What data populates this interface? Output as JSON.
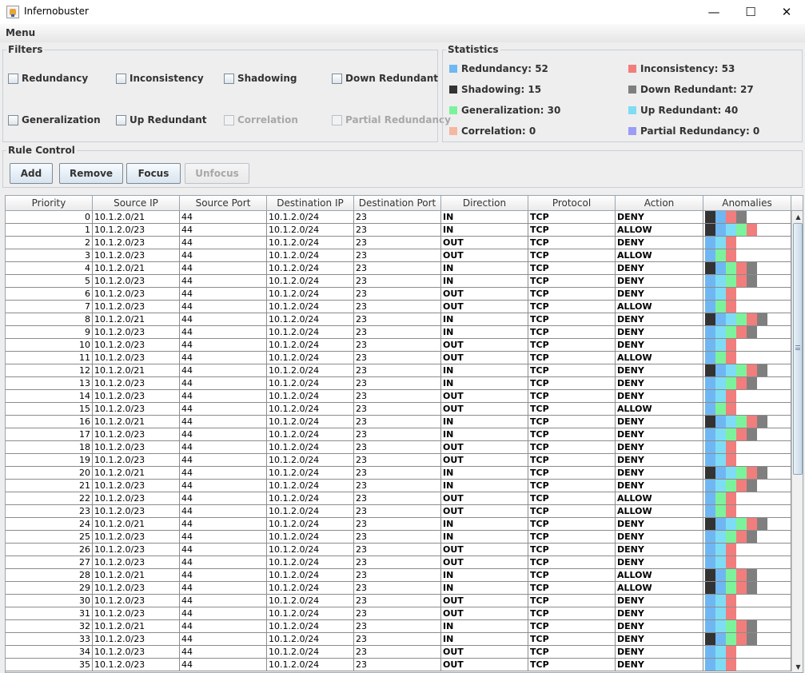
{
  "window": {
    "title": "Infernobuster",
    "minimize_glyph": "—",
    "maximize_glyph": "☐",
    "close_glyph": "✕"
  },
  "menubar": {
    "menu_label": "Menu"
  },
  "filters": {
    "title": "Filters",
    "items": [
      {
        "label": "Redundancy",
        "enabled": true,
        "checked": false
      },
      {
        "label": "Inconsistency",
        "enabled": true,
        "checked": false
      },
      {
        "label": "Shadowing",
        "enabled": true,
        "checked": false
      },
      {
        "label": "Down Redundant",
        "enabled": true,
        "checked": false
      },
      {
        "label": "Generalization",
        "enabled": true,
        "checked": false
      },
      {
        "label": "Up Redundant",
        "enabled": true,
        "checked": false
      },
      {
        "label": "Correlation",
        "enabled": false,
        "checked": false
      },
      {
        "label": "Partial Redundancy",
        "enabled": false,
        "checked": false
      }
    ]
  },
  "statistics": {
    "title": "Statistics",
    "items": [
      {
        "label": "Redundancy: 52",
        "color": "#6fb7f2"
      },
      {
        "label": "Inconsistency: 53",
        "color": "#f27d7d"
      },
      {
        "label": "Shadowing: 15",
        "color": "#333333"
      },
      {
        "label": "Down Redundant: 27",
        "color": "#7f7f7f"
      },
      {
        "label": "Generalization: 30",
        "color": "#7df29c"
      },
      {
        "label": "Up Redundant: 40",
        "color": "#7fdcf5"
      },
      {
        "label": "Correlation: 0",
        "color": "#f5b7a0"
      },
      {
        "label": "Partial Redundancy: 0",
        "color": "#9c9cf5"
      }
    ]
  },
  "rule_control": {
    "title": "Rule Control",
    "add_label": "Add",
    "remove_label": "Remove",
    "focus_label": "Focus",
    "unfocus_label": "Unfocus"
  },
  "anomaly_colors": {
    "S": "#333333",
    "R": "#6fb7f2",
    "U": "#7fdcf5",
    "G": "#7df29c",
    "I": "#f27d7d",
    "D": "#7f7f7f"
  },
  "table": {
    "columns": [
      "Priority",
      "Source IP",
      "Source Port",
      "Destination IP",
      "Destination Port",
      "Direction",
      "Protocol",
      "Action",
      "Anomalies"
    ],
    "rows": [
      {
        "priority": "0",
        "src_ip": "10.1.2.0/21",
        "src_port": "44",
        "dst_ip": "10.1.2.0/24",
        "dst_port": "23",
        "direction": "IN",
        "protocol": "TCP",
        "action": "DENY",
        "anomalies": [
          "S",
          "R",
          "I",
          "D"
        ]
      },
      {
        "priority": "1",
        "src_ip": "10.1.2.0/23",
        "src_port": "44",
        "dst_ip": "10.1.2.0/24",
        "dst_port": "23",
        "direction": "IN",
        "protocol": "TCP",
        "action": "ALLOW",
        "anomalies": [
          "S",
          "R",
          "U",
          "G",
          "I"
        ]
      },
      {
        "priority": "2",
        "src_ip": "10.1.2.0/23",
        "src_port": "44",
        "dst_ip": "10.1.2.0/24",
        "dst_port": "23",
        "direction": "OUT",
        "protocol": "TCP",
        "action": "DENY",
        "anomalies": [
          "R",
          "U",
          "I"
        ]
      },
      {
        "priority": "3",
        "src_ip": "10.1.2.0/23",
        "src_port": "44",
        "dst_ip": "10.1.2.0/24",
        "dst_port": "23",
        "direction": "OUT",
        "protocol": "TCP",
        "action": "ALLOW",
        "anomalies": [
          "R",
          "G",
          "I"
        ]
      },
      {
        "priority": "4",
        "src_ip": "10.1.2.0/21",
        "src_port": "44",
        "dst_ip": "10.1.2.0/24",
        "dst_port": "23",
        "direction": "IN",
        "protocol": "TCP",
        "action": "DENY",
        "anomalies": [
          "S",
          "R",
          "G",
          "I",
          "D"
        ]
      },
      {
        "priority": "5",
        "src_ip": "10.1.2.0/23",
        "src_port": "44",
        "dst_ip": "10.1.2.0/24",
        "dst_port": "23",
        "direction": "IN",
        "protocol": "TCP",
        "action": "DENY",
        "anomalies": [
          "R",
          "U",
          "G",
          "I",
          "D"
        ]
      },
      {
        "priority": "6",
        "src_ip": "10.1.2.0/23",
        "src_port": "44",
        "dst_ip": "10.1.2.0/24",
        "dst_port": "23",
        "direction": "OUT",
        "protocol": "TCP",
        "action": "DENY",
        "anomalies": [
          "R",
          "U",
          "I"
        ]
      },
      {
        "priority": "7",
        "src_ip": "10.1.2.0/23",
        "src_port": "44",
        "dst_ip": "10.1.2.0/24",
        "dst_port": "23",
        "direction": "OUT",
        "protocol": "TCP",
        "action": "ALLOW",
        "anomalies": [
          "R",
          "G",
          "I"
        ]
      },
      {
        "priority": "8",
        "src_ip": "10.1.2.0/21",
        "src_port": "44",
        "dst_ip": "10.1.2.0/24",
        "dst_port": "23",
        "direction": "IN",
        "protocol": "TCP",
        "action": "DENY",
        "anomalies": [
          "S",
          "R",
          "U",
          "G",
          "I",
          "D"
        ]
      },
      {
        "priority": "9",
        "src_ip": "10.1.2.0/23",
        "src_port": "44",
        "dst_ip": "10.1.2.0/24",
        "dst_port": "23",
        "direction": "IN",
        "protocol": "TCP",
        "action": "DENY",
        "anomalies": [
          "R",
          "U",
          "G",
          "I",
          "D"
        ]
      },
      {
        "priority": "10",
        "src_ip": "10.1.2.0/23",
        "src_port": "44",
        "dst_ip": "10.1.2.0/24",
        "dst_port": "23",
        "direction": "OUT",
        "protocol": "TCP",
        "action": "DENY",
        "anomalies": [
          "R",
          "U",
          "I"
        ]
      },
      {
        "priority": "11",
        "src_ip": "10.1.2.0/23",
        "src_port": "44",
        "dst_ip": "10.1.2.0/24",
        "dst_port": "23",
        "direction": "OUT",
        "protocol": "TCP",
        "action": "ALLOW",
        "anomalies": [
          "R",
          "G",
          "I"
        ]
      },
      {
        "priority": "12",
        "src_ip": "10.1.2.0/21",
        "src_port": "44",
        "dst_ip": "10.1.2.0/24",
        "dst_port": "23",
        "direction": "IN",
        "protocol": "TCP",
        "action": "DENY",
        "anomalies": [
          "S",
          "R",
          "U",
          "G",
          "I",
          "D"
        ]
      },
      {
        "priority": "13",
        "src_ip": "10.1.2.0/23",
        "src_port": "44",
        "dst_ip": "10.1.2.0/24",
        "dst_port": "23",
        "direction": "IN",
        "protocol": "TCP",
        "action": "DENY",
        "anomalies": [
          "R",
          "U",
          "G",
          "I",
          "D"
        ]
      },
      {
        "priority": "14",
        "src_ip": "10.1.2.0/23",
        "src_port": "44",
        "dst_ip": "10.1.2.0/24",
        "dst_port": "23",
        "direction": "OUT",
        "protocol": "TCP",
        "action": "DENY",
        "anomalies": [
          "R",
          "U",
          "I"
        ]
      },
      {
        "priority": "15",
        "src_ip": "10.1.2.0/23",
        "src_port": "44",
        "dst_ip": "10.1.2.0/24",
        "dst_port": "23",
        "direction": "OUT",
        "protocol": "TCP",
        "action": "ALLOW",
        "anomalies": [
          "R",
          "G",
          "I"
        ]
      },
      {
        "priority": "16",
        "src_ip": "10.1.2.0/21",
        "src_port": "44",
        "dst_ip": "10.1.2.0/24",
        "dst_port": "23",
        "direction": "IN",
        "protocol": "TCP",
        "action": "DENY",
        "anomalies": [
          "S",
          "R",
          "U",
          "G",
          "I",
          "D"
        ]
      },
      {
        "priority": "17",
        "src_ip": "10.1.2.0/23",
        "src_port": "44",
        "dst_ip": "10.1.2.0/24",
        "dst_port": "23",
        "direction": "IN",
        "protocol": "TCP",
        "action": "DENY",
        "anomalies": [
          "R",
          "U",
          "G",
          "I",
          "D"
        ]
      },
      {
        "priority": "18",
        "src_ip": "10.1.2.0/23",
        "src_port": "44",
        "dst_ip": "10.1.2.0/24",
        "dst_port": "23",
        "direction": "OUT",
        "protocol": "TCP",
        "action": "DENY",
        "anomalies": [
          "R",
          "U",
          "I"
        ]
      },
      {
        "priority": "19",
        "src_ip": "10.1.2.0/23",
        "src_port": "44",
        "dst_ip": "10.1.2.0/24",
        "dst_port": "23",
        "direction": "OUT",
        "protocol": "TCP",
        "action": "DENY",
        "anomalies": [
          "R",
          "U",
          "I"
        ]
      },
      {
        "priority": "20",
        "src_ip": "10.1.2.0/21",
        "src_port": "44",
        "dst_ip": "10.1.2.0/24",
        "dst_port": "23",
        "direction": "IN",
        "protocol": "TCP",
        "action": "DENY",
        "anomalies": [
          "S",
          "R",
          "U",
          "G",
          "I",
          "D"
        ]
      },
      {
        "priority": "21",
        "src_ip": "10.1.2.0/23",
        "src_port": "44",
        "dst_ip": "10.1.2.0/24",
        "dst_port": "23",
        "direction": "IN",
        "protocol": "TCP",
        "action": "DENY",
        "anomalies": [
          "R",
          "U",
          "G",
          "I",
          "D"
        ]
      },
      {
        "priority": "22",
        "src_ip": "10.1.2.0/23",
        "src_port": "44",
        "dst_ip": "10.1.2.0/24",
        "dst_port": "23",
        "direction": "OUT",
        "protocol": "TCP",
        "action": "ALLOW",
        "anomalies": [
          "R",
          "G",
          "I"
        ]
      },
      {
        "priority": "23",
        "src_ip": "10.1.2.0/23",
        "src_port": "44",
        "dst_ip": "10.1.2.0/24",
        "dst_port": "23",
        "direction": "OUT",
        "protocol": "TCP",
        "action": "ALLOW",
        "anomalies": [
          "R",
          "G",
          "I"
        ]
      },
      {
        "priority": "24",
        "src_ip": "10.1.2.0/21",
        "src_port": "44",
        "dst_ip": "10.1.2.0/24",
        "dst_port": "23",
        "direction": "IN",
        "protocol": "TCP",
        "action": "DENY",
        "anomalies": [
          "S",
          "R",
          "U",
          "G",
          "I",
          "D"
        ]
      },
      {
        "priority": "25",
        "src_ip": "10.1.2.0/23",
        "src_port": "44",
        "dst_ip": "10.1.2.0/24",
        "dst_port": "23",
        "direction": "IN",
        "protocol": "TCP",
        "action": "DENY",
        "anomalies": [
          "R",
          "U",
          "G",
          "I",
          "D"
        ]
      },
      {
        "priority": "26",
        "src_ip": "10.1.2.0/23",
        "src_port": "44",
        "dst_ip": "10.1.2.0/24",
        "dst_port": "23",
        "direction": "OUT",
        "protocol": "TCP",
        "action": "DENY",
        "anomalies": [
          "R",
          "U",
          "I"
        ]
      },
      {
        "priority": "27",
        "src_ip": "10.1.2.0/23",
        "src_port": "44",
        "dst_ip": "10.1.2.0/24",
        "dst_port": "23",
        "direction": "OUT",
        "protocol": "TCP",
        "action": "DENY",
        "anomalies": [
          "R",
          "U",
          "I"
        ]
      },
      {
        "priority": "28",
        "src_ip": "10.1.2.0/21",
        "src_port": "44",
        "dst_ip": "10.1.2.0/24",
        "dst_port": "23",
        "direction": "IN",
        "protocol": "TCP",
        "action": "ALLOW",
        "anomalies": [
          "S",
          "R",
          "G",
          "I",
          "D"
        ]
      },
      {
        "priority": "29",
        "src_ip": "10.1.2.0/23",
        "src_port": "44",
        "dst_ip": "10.1.2.0/24",
        "dst_port": "23",
        "direction": "IN",
        "protocol": "TCP",
        "action": "ALLOW",
        "anomalies": [
          "S",
          "R",
          "G",
          "I",
          "D"
        ]
      },
      {
        "priority": "30",
        "src_ip": "10.1.2.0/23",
        "src_port": "44",
        "dst_ip": "10.1.2.0/24",
        "dst_port": "23",
        "direction": "OUT",
        "protocol": "TCP",
        "action": "DENY",
        "anomalies": [
          "R",
          "U",
          "I"
        ]
      },
      {
        "priority": "31",
        "src_ip": "10.1.2.0/23",
        "src_port": "44",
        "dst_ip": "10.1.2.0/24",
        "dst_port": "23",
        "direction": "OUT",
        "protocol": "TCP",
        "action": "DENY",
        "anomalies": [
          "R",
          "U",
          "I"
        ]
      },
      {
        "priority": "32",
        "src_ip": "10.1.2.0/21",
        "src_port": "44",
        "dst_ip": "10.1.2.0/24",
        "dst_port": "23",
        "direction": "IN",
        "protocol": "TCP",
        "action": "DENY",
        "anomalies": [
          "R",
          "U",
          "G",
          "I",
          "D"
        ]
      },
      {
        "priority": "33",
        "src_ip": "10.1.2.0/23",
        "src_port": "44",
        "dst_ip": "10.1.2.0/24",
        "dst_port": "23",
        "direction": "IN",
        "protocol": "TCP",
        "action": "DENY",
        "anomalies": [
          "S",
          "R",
          "G",
          "I",
          "D"
        ]
      },
      {
        "priority": "34",
        "src_ip": "10.1.2.0/23",
        "src_port": "44",
        "dst_ip": "10.1.2.0/24",
        "dst_port": "23",
        "direction": "OUT",
        "protocol": "TCP",
        "action": "DENY",
        "anomalies": [
          "R",
          "U",
          "I"
        ]
      },
      {
        "priority": "35",
        "src_ip": "10.1.2.0/23",
        "src_port": "44",
        "dst_ip": "10.1.2.0/24",
        "dst_port": "23",
        "direction": "OUT",
        "protocol": "TCP",
        "action": "DENY",
        "anomalies": [
          "R",
          "U",
          "I"
        ]
      }
    ]
  },
  "scrollbar": {
    "up_glyph": "▲",
    "down_glyph": "▼"
  }
}
